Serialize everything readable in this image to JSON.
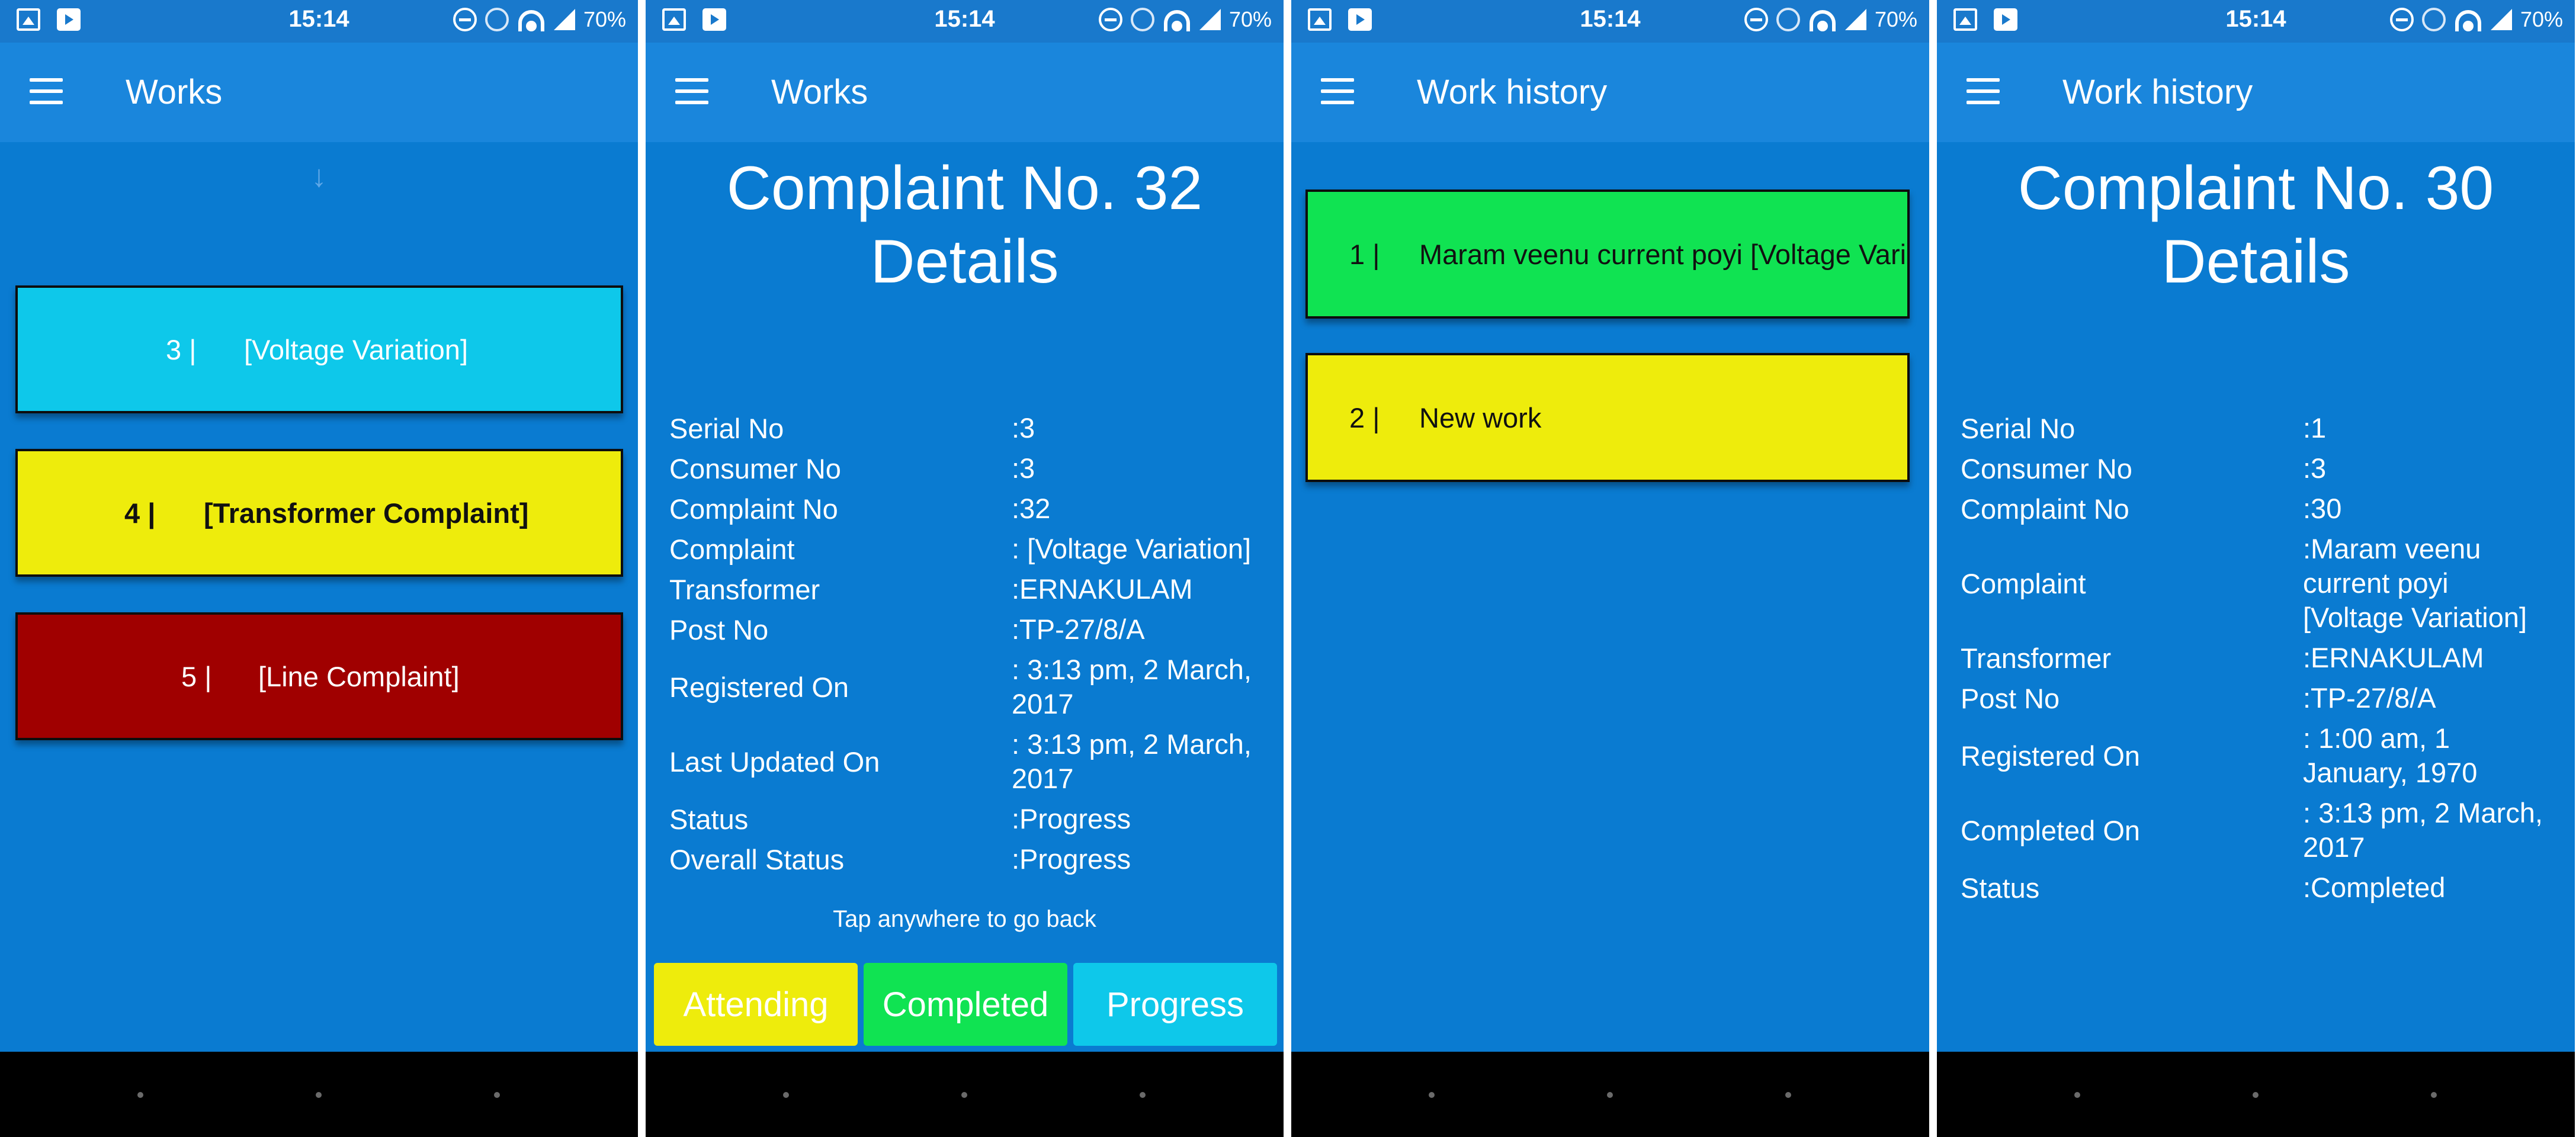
{
  "status_bar": {
    "time": "15:14",
    "battery": "70%"
  },
  "screen1": {
    "title": "Works",
    "pull_hint": "↓",
    "items": [
      {
        "number": "3 |",
        "label": "[Voltage Variation]",
        "color": "#0ec8ea"
      },
      {
        "number": "4 |",
        "label": "[Transformer Complaint]",
        "color": "#eeec0c"
      },
      {
        "number": "5 |",
        "label": "[Line Complaint]",
        "color": "#a00000"
      }
    ]
  },
  "screen2": {
    "title": "Works",
    "heading_line1": "Complaint No. 32",
    "heading_line2": "Details",
    "rows": [
      {
        "key": "Serial No",
        "value": ":3"
      },
      {
        "key": "Consumer No",
        "value": ":3"
      },
      {
        "key": "Complaint No",
        "value": ":32"
      },
      {
        "key": "Complaint",
        "value": ": [Voltage Variation]"
      },
      {
        "key": "Transformer",
        "value": ":ERNAKULAM"
      },
      {
        "key": "Post No",
        "value": ":TP-27/8/A"
      },
      {
        "key": "Registered On",
        "value": ": 3:13 pm, 2 March, 2017"
      },
      {
        "key": "Last Updated On",
        "value": ": 3:13 pm, 2 March, 2017"
      },
      {
        "key": "Status",
        "value": ":Progress"
      },
      {
        "key": "Overall Status",
        "value": ":Progress"
      }
    ],
    "tap_hint": "Tap anywhere to go back",
    "buttons": {
      "attending": "Attending",
      "completed": "Completed",
      "progress": "Progress"
    }
  },
  "screen3": {
    "title": "Work history",
    "items": [
      {
        "number": "1 |",
        "label": "Maram veenu current poyi [Voltage Variation]",
        "color": "#10e352"
      },
      {
        "number": "2 |",
        "label": "New work",
        "color": "#eeec0c"
      }
    ]
  },
  "screen4": {
    "title": "Work history",
    "heading_line1": "Complaint No. 30",
    "heading_line2": "Details",
    "rows": [
      {
        "key": "Serial No",
        "value": ":1"
      },
      {
        "key": "Consumer No",
        "value": ":3"
      },
      {
        "key": "Complaint No",
        "value": ":30"
      },
      {
        "key": "Complaint",
        "value": ":Maram veenu current poyi [Voltage Variation]"
      },
      {
        "key": "Transformer",
        "value": ":ERNAKULAM"
      },
      {
        "key": "Post No",
        "value": ":TP-27/8/A"
      },
      {
        "key": "Registered On",
        "value": ": 1:00 am, 1 January, 1970"
      },
      {
        "key": "Completed On",
        "value": ": 3:13 pm, 2 March, 2017"
      },
      {
        "key": "Status",
        "value": ":Completed"
      }
    ]
  },
  "icons": {
    "status_left": [
      "image-notification-icon",
      "store-notification-icon"
    ],
    "status_right": [
      "do-not-disturb-icon",
      "alarm-icon",
      "wifi-icon",
      "cell-signal-icon"
    ],
    "menu": "hamburger-menu-icon"
  }
}
